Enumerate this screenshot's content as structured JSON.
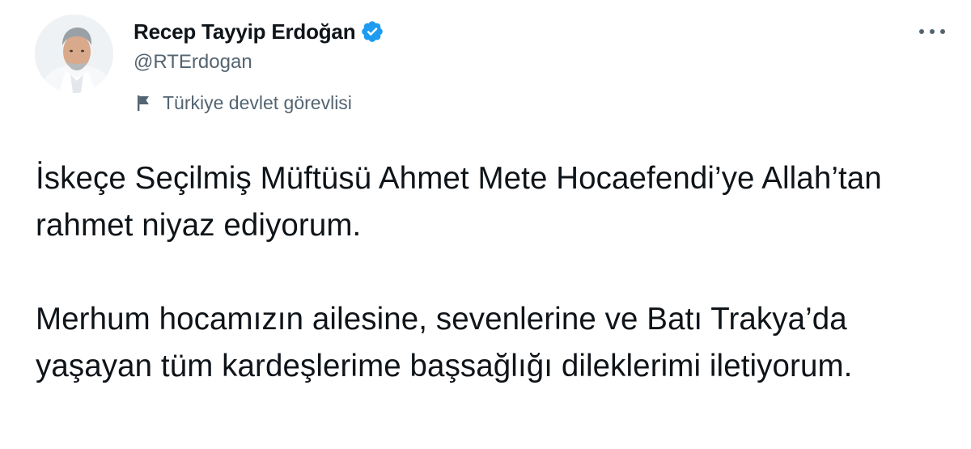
{
  "author": {
    "display_name": "Recep Tayyip Erdoğan",
    "handle": "@RTErdogan",
    "verified": true,
    "label": "Türkiye devlet görevlisi",
    "label_icon": "flag-icon",
    "avatar_icon": "avatar"
  },
  "actions": {
    "more_icon": "more-icon"
  },
  "tweet": {
    "paragraphs": [
      "İskeçe Seçilmiş Müftüsü Ahmet Mete Hocaefendi’ye Allah’tan rahmet niyaz ediyorum.",
      "Merhum hocamızın ailesine, sevenlerine ve Batı Trakya’da yaşayan tüm kardeşlerime başsağlığı dileklerimi iletiyorum."
    ]
  },
  "colors": {
    "text": "#0f1419",
    "secondary": "#536471",
    "verified": "#1d9bf0",
    "background": "#ffffff"
  }
}
